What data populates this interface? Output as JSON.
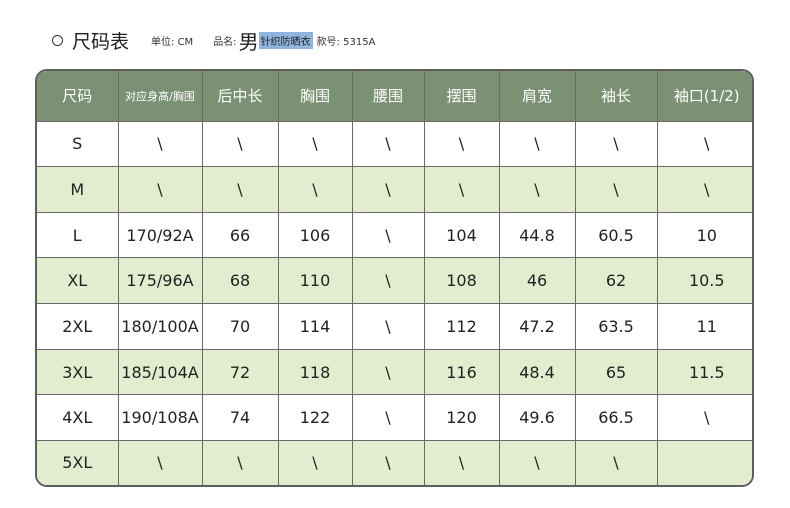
{
  "header": {
    "title": "尺码表",
    "unit_text": "单位: CM",
    "name_label": "品名:",
    "name_gender": "男",
    "name_product": "针织防晒衣",
    "style_text": "款号: 5315A"
  },
  "table": {
    "columns": [
      "尺码",
      "对应身高/胸围",
      "后中长",
      "胸围",
      "腰围",
      "摆围",
      "肩宽",
      "袖长",
      "袖口(1/2)"
    ],
    "rows": [
      [
        "S",
        "\\",
        "\\",
        "\\",
        "\\",
        "\\",
        "\\",
        "\\",
        "\\"
      ],
      [
        "M",
        "\\",
        "\\",
        "\\",
        "\\",
        "\\",
        "\\",
        "\\",
        "\\"
      ],
      [
        "L",
        "170/92A",
        "66",
        "106",
        "\\",
        "104",
        "44.8",
        "60.5",
        "10"
      ],
      [
        "XL",
        "175/96A",
        "68",
        "110",
        "\\",
        "108",
        "46",
        "62",
        "10.5"
      ],
      [
        "2XL",
        "180/100A",
        "70",
        "114",
        "\\",
        "112",
        "47.2",
        "63.5",
        "11"
      ],
      [
        "3XL",
        "185/104A",
        "72",
        "118",
        "\\",
        "116",
        "48.4",
        "65",
        "11.5"
      ],
      [
        "4XL",
        "190/108A",
        "74",
        "122",
        "\\",
        "120",
        "49.6",
        "66.5",
        "\\"
      ],
      [
        "5XL",
        "\\",
        "\\",
        "\\",
        "\\",
        "\\",
        "\\",
        "\\",
        ""
      ]
    ]
  },
  "colors": {
    "header_bg": "#7b9173",
    "alt_row_bg": "#e2edcf",
    "selection_bg": "#8fb4e0"
  }
}
